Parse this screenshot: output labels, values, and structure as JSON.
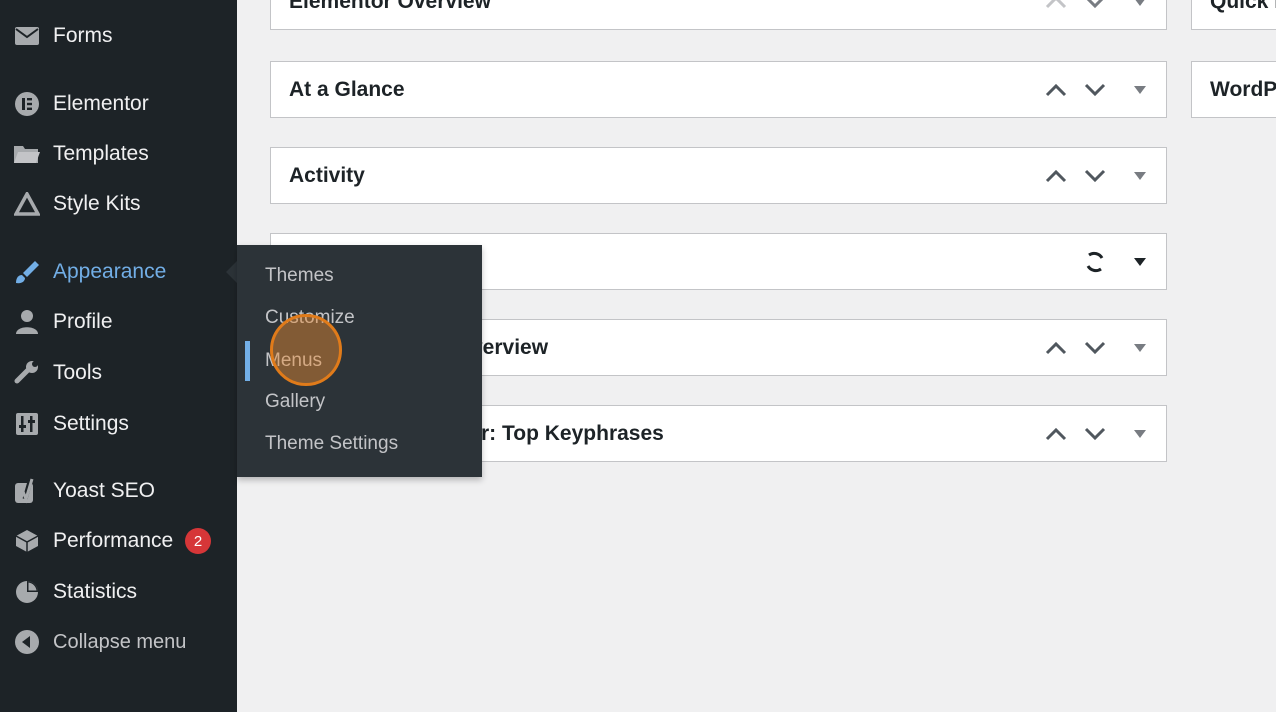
{
  "sidebar": {
    "items": [
      {
        "label": "Forms",
        "icon": "envelope-icon"
      },
      {
        "label": "Elementor",
        "icon": "elementor-icon"
      },
      {
        "label": "Templates",
        "icon": "folder-icon"
      },
      {
        "label": "Style Kits",
        "icon": "triangle-icon"
      },
      {
        "label": "Appearance",
        "icon": "paintbrush-icon"
      },
      {
        "label": "Profile",
        "icon": "user-icon"
      },
      {
        "label": "Tools",
        "icon": "wrench-icon"
      },
      {
        "label": "Settings",
        "icon": "sliders-icon"
      },
      {
        "label": "Yoast SEO",
        "icon": "yoast-icon"
      },
      {
        "label": "Performance",
        "icon": "performance-icon",
        "badge": "2"
      },
      {
        "label": "Statistics",
        "icon": "pie-chart-icon"
      },
      {
        "label": "Collapse menu",
        "icon": "collapse-icon"
      }
    ]
  },
  "flyout": {
    "items": [
      {
        "label": "Themes"
      },
      {
        "label": "Customize"
      },
      {
        "label": "Menus"
      },
      {
        "label": "Gallery"
      },
      {
        "label": "Theme Settings"
      }
    ]
  },
  "widgets": [
    {
      "title": "Elementor Overview"
    },
    {
      "title": "At a Glance"
    },
    {
      "title": "Activity"
    },
    {
      "title": ""
    },
    {
      "title": "verview"
    },
    {
      "title": "r: Top Keyphrases"
    }
  ],
  "right_widgets": [
    {
      "title": "Quick D"
    },
    {
      "title": "WordP"
    }
  ],
  "colors": {
    "sidebar_bg": "#1d2327",
    "flyout_bg": "#2c3338",
    "accent": "#72aee6",
    "badge": "#d63638",
    "click_ring": "#e07b1a"
  }
}
